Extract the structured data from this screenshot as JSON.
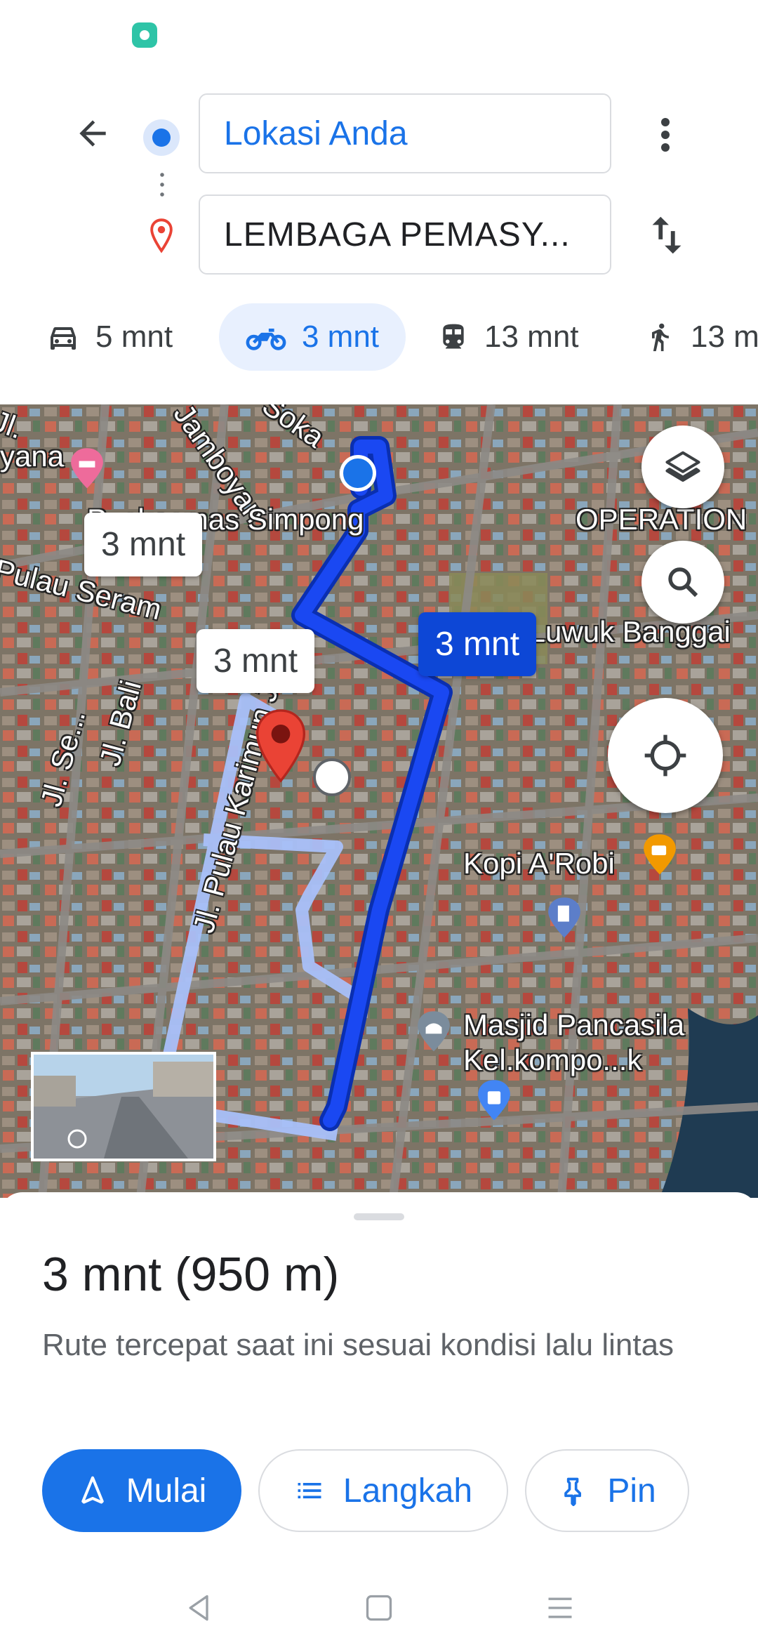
{
  "origin": {
    "label": "Lokasi Anda"
  },
  "destination": {
    "label": "LEMBAGA PEMASY..."
  },
  "modes": [
    {
      "icon": "car-icon",
      "time": "5 mnt"
    },
    {
      "icon": "motorcycle-icon",
      "time": "3 mnt",
      "selected": true
    },
    {
      "icon": "transit-icon",
      "time": "13 mnt"
    },
    {
      "icon": "walk-icon",
      "time": "13 mnt"
    }
  ],
  "map": {
    "labels": {
      "puskesmas": "Puskesmas Simpong",
      "pulau_seram": "Pulau Seram",
      "kfc": "KFC Luwuk Banggai",
      "kopi": "Kopi A'Robi",
      "masjid_1": "Masjid Pancasila",
      "masjid_2": "Kel.kompo...k",
      "operation": "OPERATION",
      "yana": "yana",
      "jamboyan": "Jamboyan",
      "soka": "Soka",
      "karimun": "Jl. Pulau Karimun Jaya",
      "bali": "Jl. Bali",
      "jl_se": "Jl. Se...",
      "jl_short": "Jl."
    },
    "callouts": {
      "primary": "3 mnt",
      "alt1": "3 mnt",
      "alt2": "3 mnt"
    },
    "colors": {
      "route": "#1a48f2",
      "alt_route": "#a9c0f9"
    }
  },
  "summary": {
    "title": "3 mnt (950 m)",
    "description": "Rute tercepat saat ini sesuai kondisi lalu lintas"
  },
  "actions": {
    "start": "Mulai",
    "steps": "Langkah",
    "pin": "Pin"
  },
  "colors": {
    "accent": "#1a73e8",
    "pin_red": "#ea4335"
  }
}
